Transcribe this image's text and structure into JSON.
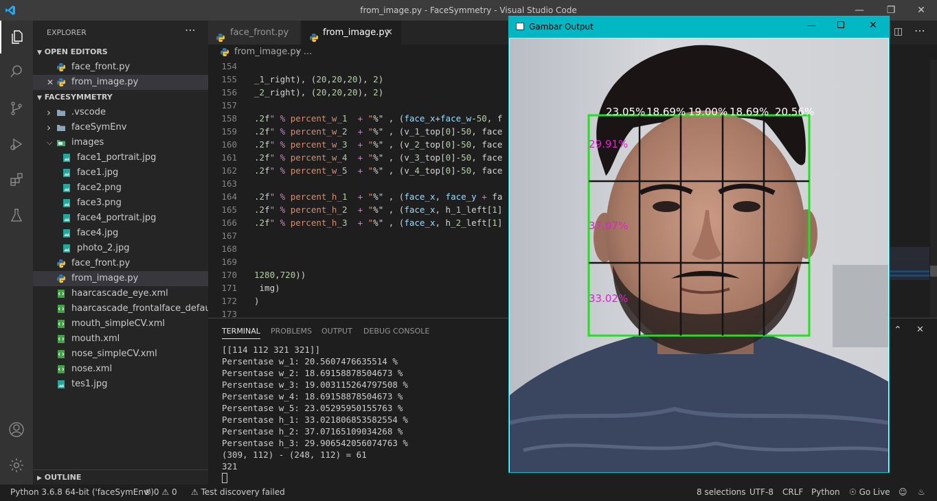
{
  "window": {
    "title": "from_image.py - FaceSymmetry - Visual Studio Code"
  },
  "sidebar": {
    "header": "EXPLORER",
    "more_icon": "ellipsis-icon",
    "open_editors_title": "OPEN EDITORS",
    "open_editors": [
      "face_front.py",
      "from_image.py"
    ],
    "project_title": "FACESYMMETRY",
    "tree": [
      {
        "label": ".vscode",
        "type": "folder",
        "depth": 1
      },
      {
        "label": "faceSymEnv",
        "type": "folder",
        "depth": 1
      },
      {
        "label": "images",
        "type": "folder-open",
        "depth": 1
      },
      {
        "label": "face1_portrait.jpg",
        "type": "image",
        "depth": 2
      },
      {
        "label": "face1.jpg",
        "type": "image",
        "depth": 2
      },
      {
        "label": "face2.png",
        "type": "image",
        "depth": 2
      },
      {
        "label": "face3.png",
        "type": "image",
        "depth": 2
      },
      {
        "label": "face4_portrait.jpg",
        "type": "image",
        "depth": 2
      },
      {
        "label": "face4.jpg",
        "type": "image",
        "depth": 2
      },
      {
        "label": "photo_2.jpg",
        "type": "image",
        "depth": 2
      },
      {
        "label": "face_front.py",
        "type": "python",
        "depth": 1
      },
      {
        "label": "from_image.py",
        "type": "python",
        "depth": 1
      },
      {
        "label": "haarcascade_eye.xml",
        "type": "xml",
        "depth": 1
      },
      {
        "label": "haarcascade_frontalface_default....",
        "type": "xml",
        "depth": 1
      },
      {
        "label": "mouth_simpleCV.xml",
        "type": "xml",
        "depth": 1
      },
      {
        "label": "mouth.xml",
        "type": "xml",
        "depth": 1
      },
      {
        "label": "nose_simpleCV.xml",
        "type": "xml",
        "depth": 1
      },
      {
        "label": "nose.xml",
        "type": "xml",
        "depth": 1
      },
      {
        "label": "tes1.jpg",
        "type": "image",
        "depth": 1
      }
    ],
    "outline_title": "OUTLINE"
  },
  "editor": {
    "tabs": [
      "face_front.py",
      "from_image.py"
    ],
    "breadcrumb_file": "from_image.py",
    "breadcrumb_more": "...",
    "lines": [
      {
        "num": "154",
        "text": ""
      },
      {
        "num": "155",
        "text": "_1_right), (20,20,20), 2)"
      },
      {
        "num": "156",
        "text": "_2_right), (20,20,20), 2)"
      },
      {
        "num": "157",
        "text": ""
      },
      {
        "num": "158",
        "text": ".2f\" % percent_w_1  + \"%\" , (face_x+face_w-50, f"
      },
      {
        "num": "159",
        "text": ".2f\" % percent_w_2  + \"%\" , (v_1_top[0]-50, face"
      },
      {
        "num": "160",
        "text": ".2f\" % percent_w_3  + \"%\" , (v_2_top[0]-50, face"
      },
      {
        "num": "161",
        "text": ".2f\" % percent_w_4  + \"%\" , (v_3_top[0]-50, face"
      },
      {
        "num": "162",
        "text": ".2f\" % percent_w_5  + \"%\" , (v_4_top[0]-50, face"
      },
      {
        "num": "163",
        "text": ""
      },
      {
        "num": "164",
        "text": ".2f\" % percent_h_1  + \"%\" , (face_x, face_y + fa"
      },
      {
        "num": "165",
        "text": ".2f\" % percent_h_2  + \"%\" , (face_x, h_1_left[1]"
      },
      {
        "num": "166",
        "text": ".2f\" % percent_h_3  + \"%\" , (face_x, h_2_left[1]"
      },
      {
        "num": "167",
        "text": ""
      },
      {
        "num": "168",
        "text": ""
      },
      {
        "num": "169",
        "text": ""
      },
      {
        "num": "170",
        "text": "1280,720))"
      },
      {
        "num": "171",
        "text": " img)"
      },
      {
        "num": "172",
        "text": ")"
      },
      {
        "num": "173",
        "text": ""
      }
    ]
  },
  "panel": {
    "tabs": [
      "TERMINAL",
      "PROBLEMS",
      "OUTPUT",
      "DEBUG CONSOLE"
    ],
    "terminal": [
      "[[114 112 321 321]]",
      "Persentase w_1: 20.5607476635514 %",
      "Persentase w_2: 18.69158878504673 %",
      "Persentase w_3: 19.003115264797508 %",
      "Persentase w_4: 18.69158878504673 %",
      "Persentase w_5: 23.05295950155763 %",
      "Persentase h_1: 33.021806853582554 %",
      "Persentase h_2: 37.07165109034268 %",
      "Persentase h_3: 29.906542056074763 %",
      "(309, 112) - (248, 112) = 61",
      "321"
    ]
  },
  "statusbar": {
    "interpreter": "Python 3.6.8 64-bit ('faceSymEnv')",
    "errors": "0",
    "warnings": "0",
    "test_status": "Test discovery failed",
    "selections": "8 selections",
    "encoding": "UTF-8",
    "eol": "CRLF",
    "language": "Python",
    "golive": "Go Live"
  },
  "output_window": {
    "title": "Gambar Output",
    "width_labels": [
      "23.05%",
      "18.69%",
      "19.00%",
      "18.69%",
      "20.56%"
    ],
    "height_labels": [
      "29.91%",
      "37.07%",
      "33.02%"
    ],
    "box_color": "#22e022",
    "line_color": "#141414",
    "height_label_color": "#e020d0"
  },
  "colors": {
    "accent": "#007acc",
    "keyword": "#c586c0",
    "string": "#ce9178",
    "number": "#b5cea8"
  }
}
